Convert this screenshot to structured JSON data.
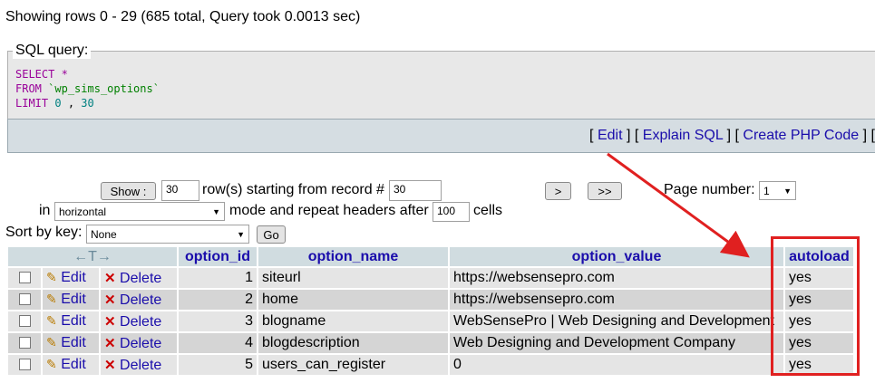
{
  "status": "Showing rows 0 - 29 (685 total, Query took 0.0013 sec)",
  "sql": {
    "legend": "SQL query:",
    "select_kw": "SELECT",
    "star": "*",
    "from_kw": "FROM",
    "table": "`wp_sims_options`",
    "limit_kw": "LIMIT",
    "offset": "0",
    "comma": ",",
    "count": "30"
  },
  "links": {
    "edit": "Edit",
    "explain": "Explain SQL",
    "php": "Create PHP Code",
    "lb": "[",
    "rb": "]"
  },
  "nav": {
    "show_button": "Show :",
    "rows_value": "30",
    "rows_label": "row(s) starting from record #",
    "start_value": "30",
    "next_button": ">",
    "last_button": ">>",
    "page_label": "Page number:",
    "page_value": "1",
    "in_label": "in",
    "mode_value": "horizontal",
    "mode_label": "mode and repeat headers after",
    "repeat_value": "100",
    "cells_label": "cells",
    "sortby_label": "Sort by key:",
    "sortby_value": "None",
    "go_button": "Go"
  },
  "table": {
    "arrows": "←T→",
    "columns": [
      "option_id",
      "option_name",
      "option_value",
      "autoload"
    ],
    "edit_label": "Edit",
    "delete_label": "Delete",
    "rows": [
      {
        "option_id": "1",
        "option_name": "siteurl",
        "option_value": "https://websensepro.com",
        "autoload": "yes"
      },
      {
        "option_id": "2",
        "option_name": "home",
        "option_value": "https://websensepro.com",
        "autoload": "yes"
      },
      {
        "option_id": "3",
        "option_name": "blogname",
        "option_value": "WebSensePro | Web Designing and Development",
        "autoload": "yes"
      },
      {
        "option_id": "4",
        "option_name": "blogdescription",
        "option_value": "Web Designing and Development Company",
        "autoload": "yes"
      },
      {
        "option_id": "5",
        "option_name": "users_can_register",
        "option_value": "0",
        "autoload": "yes"
      }
    ]
  },
  "annotation": {
    "color": "#e02020"
  }
}
